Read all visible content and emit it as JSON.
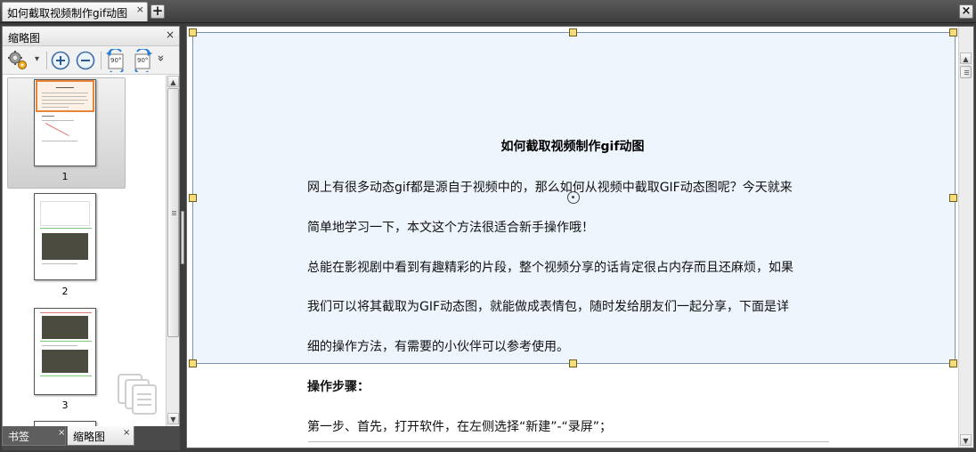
{
  "window": {
    "tab_title": "如何截取视频制作gif动图",
    "tab_close": "×",
    "new_tab": "+",
    "close": "×"
  },
  "thumbnail_panel": {
    "title": "缩略图",
    "close": "×",
    "toolbar": {
      "options_icon": "gear-icon",
      "options_dropdown": "▾",
      "zoom_in_icon": "zoom-in-icon",
      "zoom_out_icon": "zoom-out-icon",
      "rotate_left_label": "90°",
      "rotate_right_label": "90°",
      "more": "»"
    },
    "pages": [
      {
        "number": "1",
        "selected": true
      },
      {
        "number": "2",
        "selected": false
      },
      {
        "number": "3",
        "selected": false
      }
    ]
  },
  "bottom_tabs": [
    {
      "label": "书签",
      "close": "×",
      "active": false
    },
    {
      "label": "缩略图",
      "close": "×",
      "active": true
    }
  ],
  "document": {
    "title": "如何截取视频制作gif动图",
    "paragraphs": [
      "网上有很多动态gif都是源自于视频中的，那么如何从视频中截取GIF动态图呢？今天就来",
      "简单地学习一下，本文这个方法很适合新手操作哦！",
      "总能在影视剧中看到有趣精彩的片段，整个视频分享的话肯定很占内存而且还麻烦，如果",
      "我们可以将其截取为GIF动态图，就能做成表情包，随时发给朋友们一起分享，下面是详",
      "细的操作方法，有需要的小伙伴可以参考使用。"
    ],
    "steps_heading": "操作步骤：",
    "step1": "第一步、首先，打开软件，在左侧选择“新建”-“录屏”；"
  },
  "colors": {
    "selection_fill": "#eef5fd",
    "handle": "#f7dd7a",
    "thumb_highlight": "#e8843a"
  }
}
